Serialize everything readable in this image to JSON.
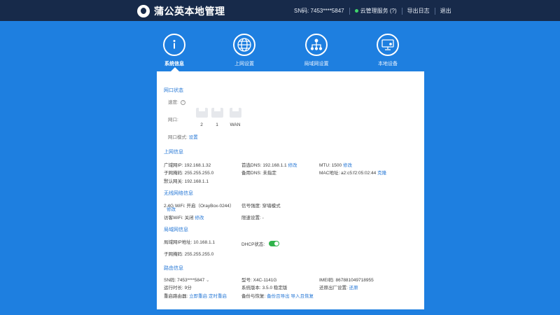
{
  "header": {
    "title": "蒲公英本地管理",
    "sn_label": "SN码: 7453****5847",
    "cloud": "云管理服务 (?)",
    "export_log": "导出日志",
    "logout": "退出"
  },
  "nav": {
    "items": [
      {
        "label": "系统信息",
        "icon": "info-icon"
      },
      {
        "label": "上网设置",
        "icon": "globe-icon"
      },
      {
        "label": "局域网设置",
        "icon": "network-icon"
      },
      {
        "label": "本地设备",
        "icon": "monitor-icon"
      }
    ],
    "active": "系统信息"
  },
  "port_status": {
    "title": "网口状态",
    "speed_label": "速度:",
    "port_label": "网口:",
    "ports": [
      "2",
      "1",
      "WAN"
    ],
    "mode_label": "网口模式:",
    "mode_action": "设置"
  },
  "internet": {
    "title": "上网信息",
    "wan_ip": "广域网IP:  192.168.1.32",
    "subnet": "子网掩码:  255.255.255.0",
    "gateway": "默认网关:  192.168.1.1",
    "dns1": "首选DNS:  192.168.1.1",
    "dns1_action": "修改",
    "dns2": "备用DNS:  未指定",
    "mtu": "MTU:  1500",
    "mtu_action": "修改",
    "mac": "MAC地址:  a2:c5:f2:05:02:44",
    "mac_action": "克隆"
  },
  "wireless": {
    "title": "无线网络信息",
    "wifi_24": "2.4G WiFi:  开启（OrayBox-0244）",
    "wifi_24_action": "修改",
    "guest": "访客WiFi:  关闭",
    "guest_action": "修改",
    "channel": "信号强度:  穿墙模式",
    "schedule": "限速设置:  -"
  },
  "lan": {
    "title": "局域网信息",
    "lan_ip": "局域网IP地址:  10.168.1.1",
    "subnet": "子网掩码:  255.255.255.0",
    "dhcp_label": "DHCP状态:",
    "dhcp_on": true
  },
  "router": {
    "title": "路由信息",
    "sn": "SN码:  7453****5847",
    "uptime": "运行时长:  9分",
    "restart_label": "重启路由器:",
    "restart_now": "立即重启",
    "restart_timer": "定时重启",
    "model": "型号:  X4C-1141G",
    "version": "系统版本:  3.5.0 稳定版",
    "backup_label": "备份与恢复:",
    "backup_export": "备份且导出",
    "backup_import": "导入且恢复",
    "imei": "IMEI码:  867881049718955",
    "factory_label": "还原出厂设置:",
    "factory_action": "还原"
  },
  "colors": {
    "background": "#1e7fe0",
    "topbar": "#172a4a",
    "accent": "#2778d6",
    "toggle_on": "#2fb34a"
  }
}
